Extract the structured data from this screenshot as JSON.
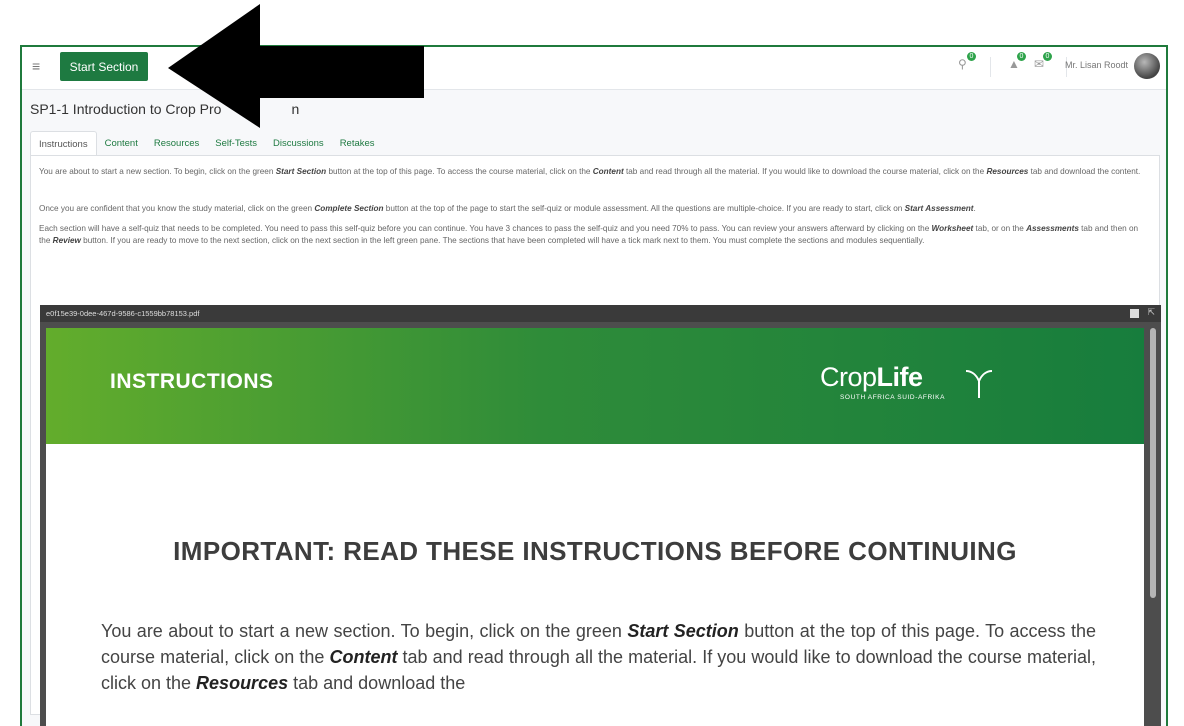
{
  "topbar": {
    "start_section_label": "Start Section",
    "cart_count": "0",
    "notifications_count": "0",
    "messages_count": "0",
    "user_name": "Mr. Lisan Roodt"
  },
  "page": {
    "title": "SP1-1 Introduction to Crop Pro",
    "title_end": "n"
  },
  "tabs": [
    {
      "label": "Instructions"
    },
    {
      "label": "Content"
    },
    {
      "label": "Resources"
    },
    {
      "label": "Self-Tests"
    },
    {
      "label": "Discussions"
    },
    {
      "label": "Retakes"
    }
  ],
  "instructions": {
    "p1": {
      "t1": "You are about to start a new section. To begin, click on the green ",
      "b1": "Start Section",
      "t2": " button at the top of this page. To access the course material, click on the ",
      "b2": "Content",
      "t3": " tab and read through all the material. If you would like to download the course material, click on the ",
      "b3": "Resources",
      "t4": " tab and download the content."
    },
    "p2": {
      "t1": "Once you are confident that you know the study material, click on the green ",
      "b1": "Complete Section",
      "t2": " button at the top of the page to start the self-quiz or module assessment. All the questions are multiple-choice. If you are ready to start, click on ",
      "b2": "Start Assessment",
      "t3": "."
    },
    "p3": {
      "t1": "Each section will have a self-quiz that needs to be completed. You need to pass this self-quiz before you can continue. You have 3 chances to pass the self-quiz and you need 70% to pass. You can review your answers afterward by clicking on the ",
      "b1": "Worksheet",
      "t2": " tab, or on the ",
      "b2": "Assessments",
      "t3": " tab and then on the ",
      "b3": "Review",
      "t4": " button. If you are ready to move to the next section, click on the next section in the left green pane. The sections that have been completed will have a tick mark next to them. You must complete the sections and modules sequentially."
    }
  },
  "pdf": {
    "filename": "e0f15e39-0dee-467d-9586-c1559bb78153.pdf",
    "banner_title": "INSTRUCTIONS",
    "logo_text_a": "Crop",
    "logo_text_b": "Life",
    "logo_subtitle": "SOUTH AFRICA  SUID-AFRIKA",
    "heading": "IMPORTANT: READ THESE INSTRUCTIONS BEFORE CONTINUING",
    "body": {
      "t1": "You are about to start a new section. To begin, click on the green ",
      "b1": "Start Section",
      "t2": " button at the top of this page. To access the course material, click on the ",
      "b2": "Content",
      "t3": " tab and read through all the material. If you would like to download the course material, click on the ",
      "b3": "Resources",
      "t4": " tab and download the"
    }
  },
  "colors": {
    "accent_green": "#1e7a41",
    "frame_border": "#1f7a3c",
    "badge_green": "#2ea34b",
    "arrow": "#000000"
  },
  "icons": [
    "menu-icon",
    "cart-icon",
    "notifications-icon",
    "messages-icon",
    "avatar",
    "fullscreen-icon",
    "sprout-logo-icon",
    "pointer-arrow-icon"
  ]
}
